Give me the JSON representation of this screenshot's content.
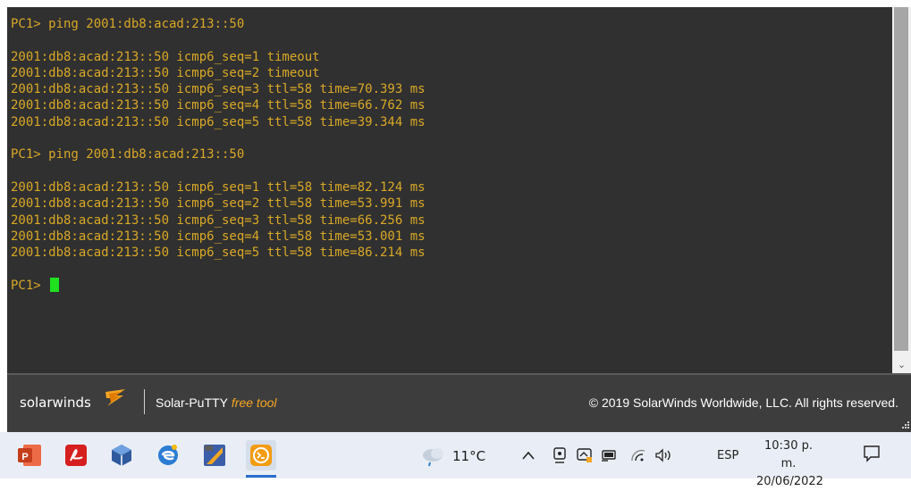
{
  "terminal": {
    "lines": [
      "PC1> ping 2001:db8:acad:213::50",
      "",
      "2001:db8:acad:213::50 icmp6_seq=1 timeout",
      "2001:db8:acad:213::50 icmp6_seq=2 timeout",
      "2001:db8:acad:213::50 icmp6_seq=3 ttl=58 time=70.393 ms",
      "2001:db8:acad:213::50 icmp6_seq=4 ttl=58 time=66.762 ms",
      "2001:db8:acad:213::50 icmp6_seq=5 ttl=58 time=39.344 ms",
      "",
      "PC1> ping 2001:db8:acad:213::50",
      "",
      "2001:db8:acad:213::50 icmp6_seq=1 ttl=58 time=82.124 ms",
      "2001:db8:acad:213::50 icmp6_seq=2 ttl=58 time=53.991 ms",
      "2001:db8:acad:213::50 icmp6_seq=3 ttl=58 time=66.256 ms",
      "2001:db8:acad:213::50 icmp6_seq=4 ttl=58 time=53.001 ms",
      "2001:db8:acad:213::50 icmp6_seq=5 ttl=58 time=86.214 ms",
      ""
    ],
    "prompt": "PC1> ",
    "text_color": "#d9a826",
    "cursor_color": "#1fe11f",
    "background": "#303030"
  },
  "footer": {
    "brand": "solarwinds",
    "product": "Solar-PuTTY",
    "product_tag": "free tool",
    "copyright": "© 2019 SolarWinds Worldwide, LLC. All rights reserved."
  },
  "taskbar": {
    "apps": [
      {
        "name": "powerpoint-icon",
        "color": "#c43e1c"
      },
      {
        "name": "acrobat-icon",
        "color": "#d61f1f"
      },
      {
        "name": "virtualbox-icon",
        "color": "#2f5a9e"
      },
      {
        "name": "browser-icon",
        "color": "#2b7cd3"
      },
      {
        "name": "solarputty-icon",
        "color": "#f5a623"
      },
      {
        "name": "terminal-app-icon",
        "color": "#f39c12"
      }
    ],
    "weather": {
      "temperature": "11°C",
      "icon": "cloud-rain-icon"
    },
    "tray_icons": [
      "chevron-up-icon",
      "meet-now-icon",
      "onedrive-icon",
      "battery-icon",
      "wifi-icon",
      "volume-icon"
    ],
    "language": "ESP",
    "time": "10:30 p. m.",
    "date": "20/06/2022"
  }
}
